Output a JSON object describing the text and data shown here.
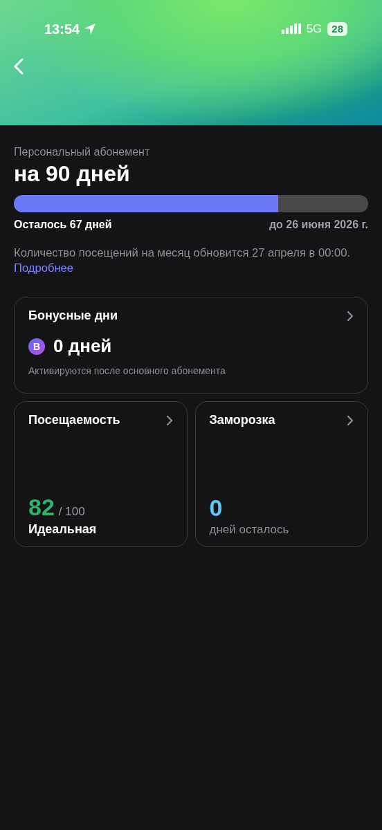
{
  "status_bar": {
    "time": "13:54",
    "network": "5G",
    "battery": "28"
  },
  "subscription": {
    "caption": "Персональный абонемент",
    "title": "на 90 дней",
    "level": 0.746,
    "remaining": "Осталось 67 дней",
    "until": "до 26 июня 2026 г.",
    "note": "Количество посещений на месяц обновится 27 апреля в 00:00.",
    "link": "Подробнее"
  },
  "bonus_card": {
    "title": "Бонусные дни",
    "badge": "B",
    "value": "0 дней",
    "hint": "Активируются после основного абонемента"
  },
  "stat_cards": [
    {
      "title": "Посещаемость",
      "value": "82",
      "total": "/ 100",
      "label": "Идеальная",
      "kind": "score",
      "color": "#2fb36b"
    },
    {
      "title": "Заморозка",
      "value": "0",
      "label": "дней осталось",
      "kind": "counter",
      "color": "#5ac8fa"
    }
  ]
}
